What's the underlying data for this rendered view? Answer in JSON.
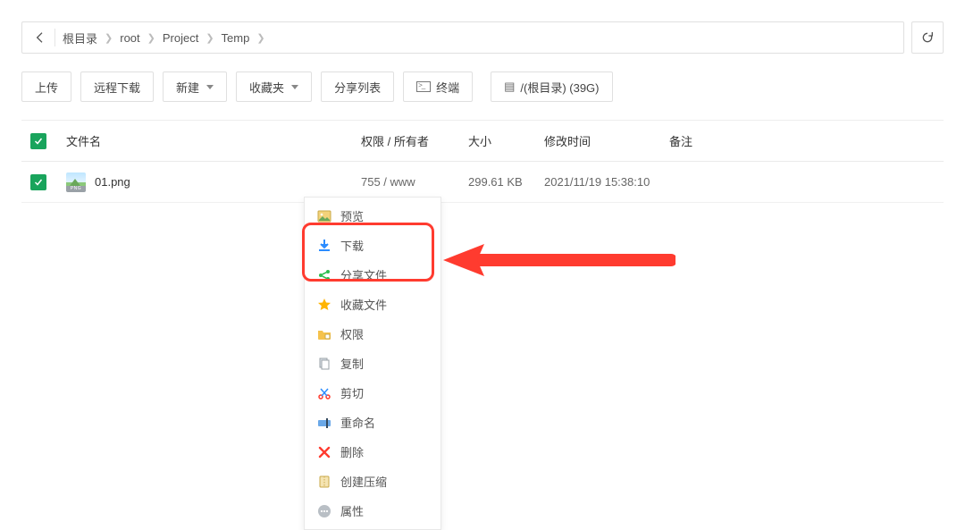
{
  "breadcrumb": {
    "items": [
      "根目录",
      "root",
      "Project",
      "Temp"
    ]
  },
  "toolbar": {
    "upload": "上传",
    "remote_download": "远程下载",
    "new": "新建",
    "favorites": "收藏夹",
    "share_list": "分享列表",
    "terminal": "终端",
    "disk": "/(根目录) (39G)"
  },
  "columns": {
    "name": "文件名",
    "perm": "权限 / 所有者",
    "size": "大小",
    "mtime": "修改时间",
    "note": "备注"
  },
  "rows": [
    {
      "name": "01.png",
      "perm": "755 / www",
      "size": "299.61 KB",
      "mtime": "2021/11/19 15:38:10",
      "note": ""
    }
  ],
  "thumb_tag": "PNG",
  "context_menu": {
    "preview": "预览",
    "download": "下载",
    "share": "分享文件",
    "favorite": "收藏文件",
    "permissions": "权限",
    "copy": "复制",
    "cut": "剪切",
    "rename": "重命名",
    "delete": "删除",
    "compress": "创建压缩",
    "properties": "属性"
  }
}
